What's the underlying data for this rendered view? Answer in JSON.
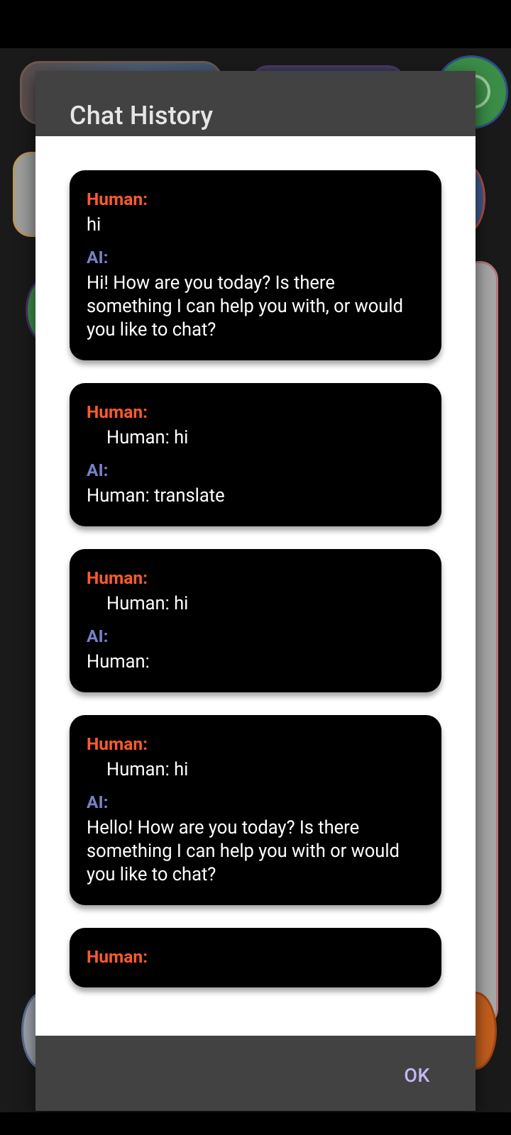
{
  "dialog": {
    "title": "Chat History",
    "ok_label": "OK"
  },
  "messages": [
    {
      "human_label": "Human:",
      "human_text": "hi",
      "human_indented": false,
      "ai_label": "AI:",
      "ai_text": "Hi! How are you today? Is there something I can help you with, or would you like to chat?"
    },
    {
      "human_label": "Human:",
      "human_text": "Human: hi",
      "human_indented": true,
      "ai_label": "AI:",
      "ai_text": "Human: translate"
    },
    {
      "human_label": "Human:",
      "human_text": "Human: hi",
      "human_indented": true,
      "ai_label": "AI:",
      "ai_text": "Human:"
    },
    {
      "human_label": "Human:",
      "human_text": "Human: hi",
      "human_indented": true,
      "ai_label": "AI:",
      "ai_text": "Hello! How are you today? Is there something I can help you with or would you like to chat?"
    },
    {
      "human_label": "Human:",
      "human_text": "",
      "human_indented": false,
      "ai_label": "",
      "ai_text": ""
    }
  ],
  "colors": {
    "human_label": "#ff5b2c",
    "ai_label": "#7a80c8",
    "accent_button": "#c7b6f5",
    "dialog_surface": "#424242",
    "card_background": "#000000"
  }
}
